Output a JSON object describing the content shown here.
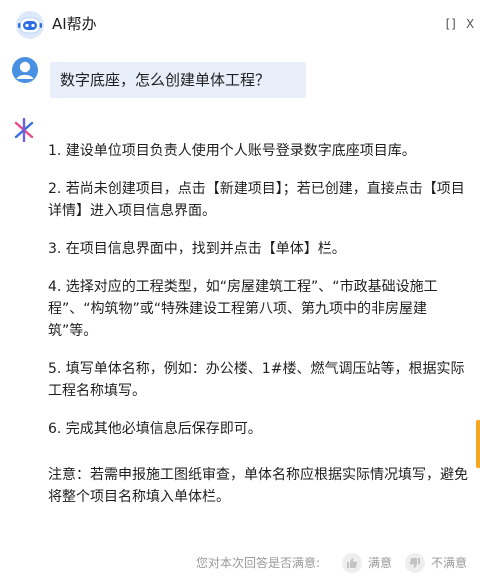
{
  "header": {
    "title": "AI帮办",
    "maximize_label": "[]",
    "close_label": "X"
  },
  "conversation": {
    "user_question": "数字底座，怎么创建单体工程？",
    "answer_paragraphs": [
      "1. 建设单位项目负责人使用个人账号登录数字底座项目库。",
      "2. 若尚未创建项目，点击【新建项目】；若已创建，直接点击【项目详情】进入项目信息界面。",
      "3. 在项目信息界面中，找到并点击【单体】栏。",
      "4. 选择对应的工程类型，如“房屋建筑工程”、“市政基础设施工程”、“构筑物”或“特殊建设工程第八项、第九项中的非房屋建筑”等。",
      "5. 填写单体名称，例如：办公楼、1#楼、燃气调压站等，根据实际工程名称填写。",
      "6. 完成其他必填信息后保存即可。"
    ],
    "note": "注意：若需申报施工图纸审查，单体名称应根据实际情况填写，避免将整个项目名称填入单体栏。"
  },
  "feedback": {
    "question": "您对本次回答是否满意:",
    "satisfied_label": "满意",
    "unsatisfied_label": "不满意"
  },
  "colors": {
    "bubble_bg": "#e9eefb",
    "user_avatar": "#4a90e2",
    "ai_star_blue": "#3b6fe0",
    "ai_star_pink": "#e94b8a",
    "edge_accent": "#f5a623"
  }
}
